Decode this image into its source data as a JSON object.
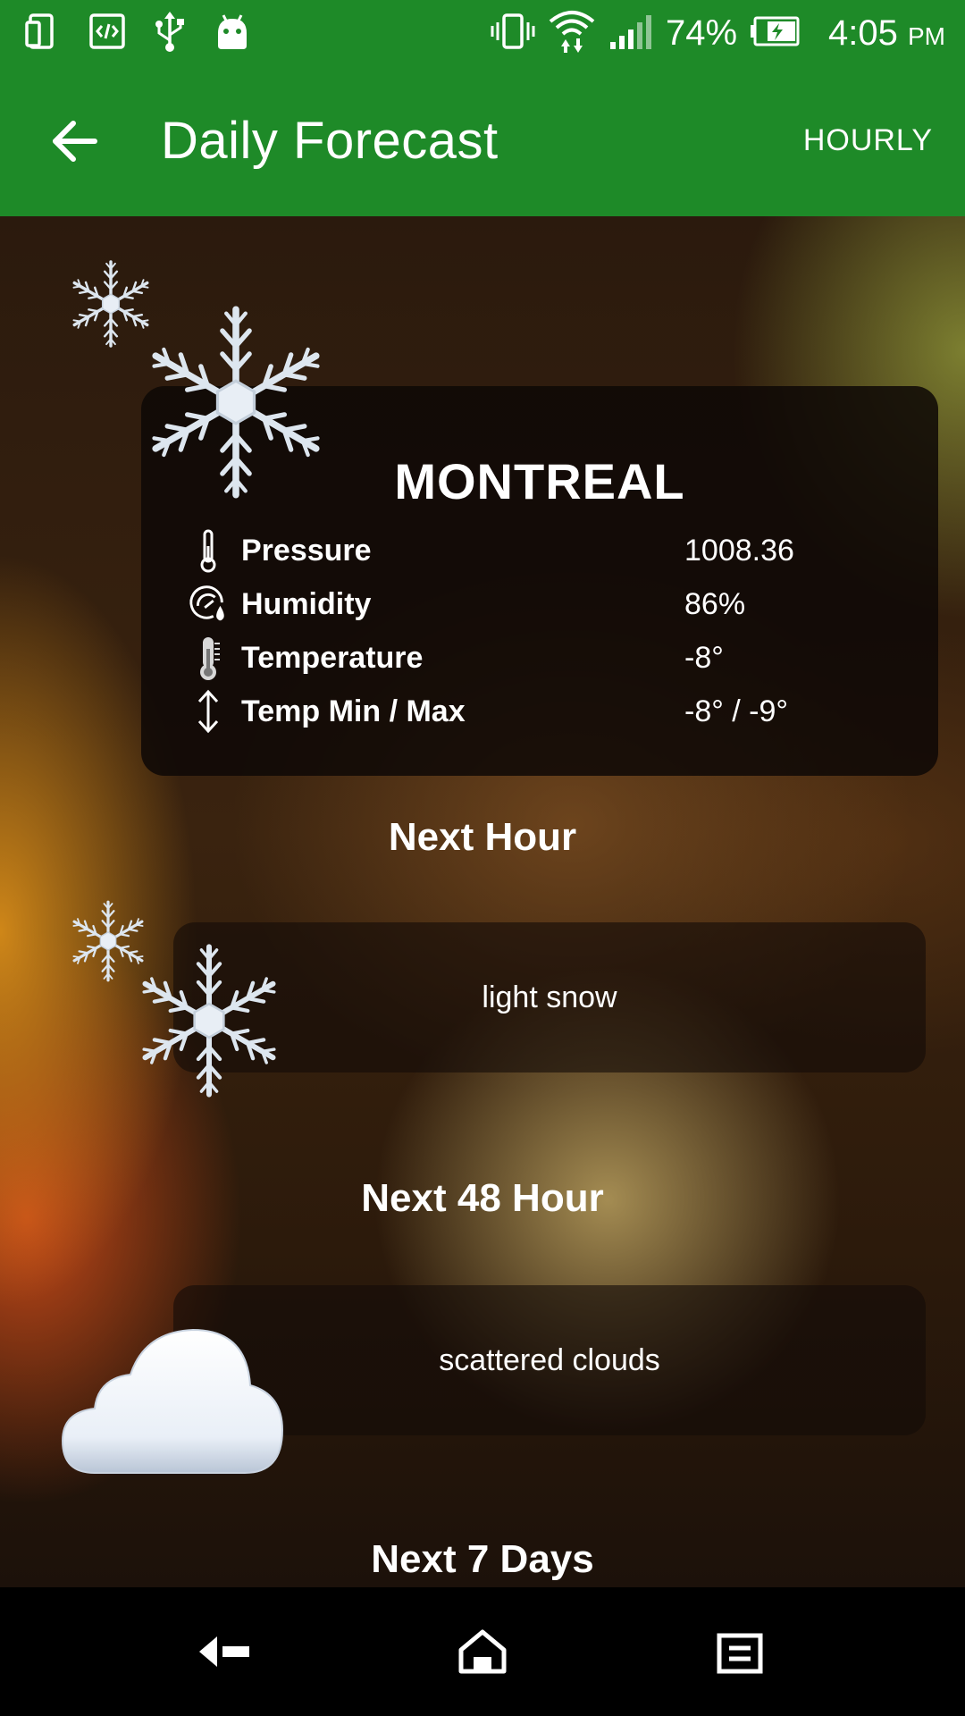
{
  "status_bar": {
    "battery_percent": "74%",
    "time": "4:05",
    "time_suffix": "PM",
    "left_icons": [
      "phone-tablet-icon",
      "code-icon",
      "usb-icon",
      "android-icon"
    ],
    "right_icons": [
      "vibrate-icon",
      "wifi-icon",
      "signal-icon",
      "battery-charging-icon"
    ]
  },
  "app_bar": {
    "title": "Daily Forecast",
    "action_label": "HOURLY",
    "background_color": "#1e8a28"
  },
  "current": {
    "city": "MONTREAL",
    "rows": [
      {
        "icon": "thermometer-thin-icon",
        "label": "Pressure",
        "value": "1008.36"
      },
      {
        "icon": "humidity-gauge-icon",
        "label": "Humidity",
        "value": "86%"
      },
      {
        "icon": "thermometer-icon",
        "label": "Temperature",
        "value": "-8°"
      },
      {
        "icon": "up-down-arrow-icon",
        "label": "Temp Min / Max",
        "value": "-8° / -9°"
      }
    ]
  },
  "sections": [
    {
      "heading": "Next Hour",
      "description": "light snow",
      "weather_icon": "snowflake-icon"
    },
    {
      "heading": "Next 48 Hour",
      "description": "scattered clouds",
      "weather_icon": "cloud-icon"
    },
    {
      "heading": "Next 7 Days"
    }
  ],
  "nav_bar": {
    "buttons": [
      "back-nav-icon",
      "home-nav-icon",
      "recents-nav-icon"
    ]
  }
}
